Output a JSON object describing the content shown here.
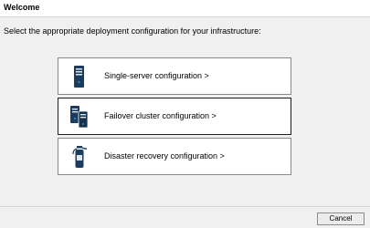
{
  "header": {
    "title": "Welcome"
  },
  "main": {
    "instructions": "Select the appropriate deployment configuration for your infrastructure:",
    "options": [
      {
        "label": "Single-server configuration >",
        "icon": "server-tower-icon"
      },
      {
        "label": "Failover cluster configuration >",
        "icon": "cluster-servers-icon"
      },
      {
        "label": "Disaster recovery configuration >",
        "icon": "fire-extinguisher-icon"
      }
    ]
  },
  "footer": {
    "cancel_label": "Cancel"
  },
  "colors": {
    "icon_dark": "#1b3c5e",
    "icon_accent": "#3c7fb1",
    "background": "#f0f0f0"
  }
}
